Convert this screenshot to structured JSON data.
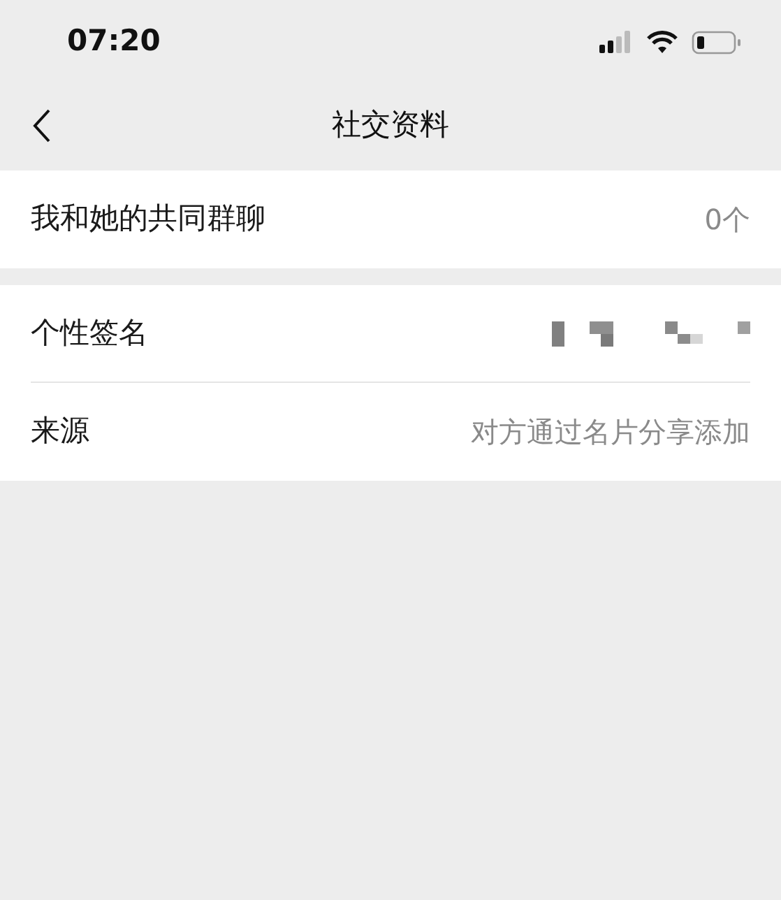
{
  "status_bar": {
    "time": "07:20"
  },
  "nav": {
    "title": "社交资料"
  },
  "groups": [
    {
      "rows": [
        {
          "kind": "text",
          "label": "我和她的共同群聊",
          "value": "0个"
        }
      ]
    },
    {
      "rows": [
        {
          "kind": "redacted",
          "label": "个性签名"
        },
        {
          "kind": "text",
          "label": "来源",
          "value": "对方通过名片分享添加"
        }
      ]
    }
  ]
}
